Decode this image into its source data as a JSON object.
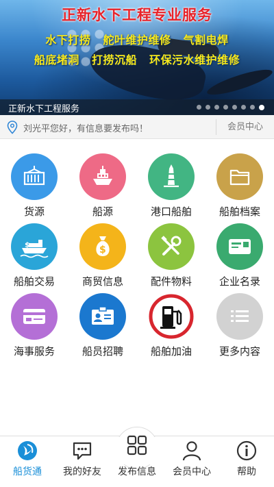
{
  "banner": {
    "title": "正新水下工程专业服务",
    "line1": [
      "水下打捞",
      "舵叶维护维修",
      "气割电焊"
    ],
    "line2": [
      "船底堵洞",
      "打捞沉船",
      "环保污水维护维修"
    ],
    "caption": "正新水下工程服务",
    "slide_count": 8,
    "active_slide": 7
  },
  "notice": {
    "greeting": "刘光平您好，有信息要发布吗！",
    "member_center": "会员中心"
  },
  "grid": [
    {
      "label": "货源",
      "icon": "container-icon",
      "color": "#3b9ae8"
    },
    {
      "label": "船源",
      "icon": "ship-icon",
      "color": "#ee6a86"
    },
    {
      "label": "港口船舶",
      "icon": "lighthouse-icon",
      "color": "#42b583"
    },
    {
      "label": "船舶档案",
      "icon": "folder-icon",
      "color": "#c9a24a"
    },
    {
      "label": "船舶交易",
      "icon": "cargo-ship-money-icon",
      "color": "#2aa5d8"
    },
    {
      "label": "商贸信息",
      "icon": "money-bag-icon",
      "color": "#f4b41a"
    },
    {
      "label": "配件物料",
      "icon": "tools-icon",
      "color": "#8cc43f"
    },
    {
      "label": "企业名录",
      "icon": "business-card-icon",
      "color": "#3aaa6f"
    },
    {
      "label": "海事服务",
      "icon": "maritime-card-icon",
      "color": "#b46fd6"
    },
    {
      "label": "船员招聘",
      "icon": "id-badge-icon",
      "color": "#1b78cf"
    },
    {
      "label": "船舶加油",
      "icon": "fuel-pump-icon",
      "color": "#ffffff"
    },
    {
      "label": "更多内容",
      "icon": "more-list-icon",
      "color": "#d2d2d2"
    }
  ],
  "nav": [
    {
      "label": "船货通",
      "icon": "app-logo-icon"
    },
    {
      "label": "我的好友",
      "icon": "chat-icon"
    },
    {
      "label": "发布信息",
      "icon": "grid-icon"
    },
    {
      "label": "会员中心",
      "icon": "user-icon"
    },
    {
      "label": "帮助",
      "icon": "info-icon"
    }
  ],
  "colors": {
    "accent": "#1a8fd8",
    "banner_title": "#e8232a",
    "banner_text": "#f7e81b"
  }
}
